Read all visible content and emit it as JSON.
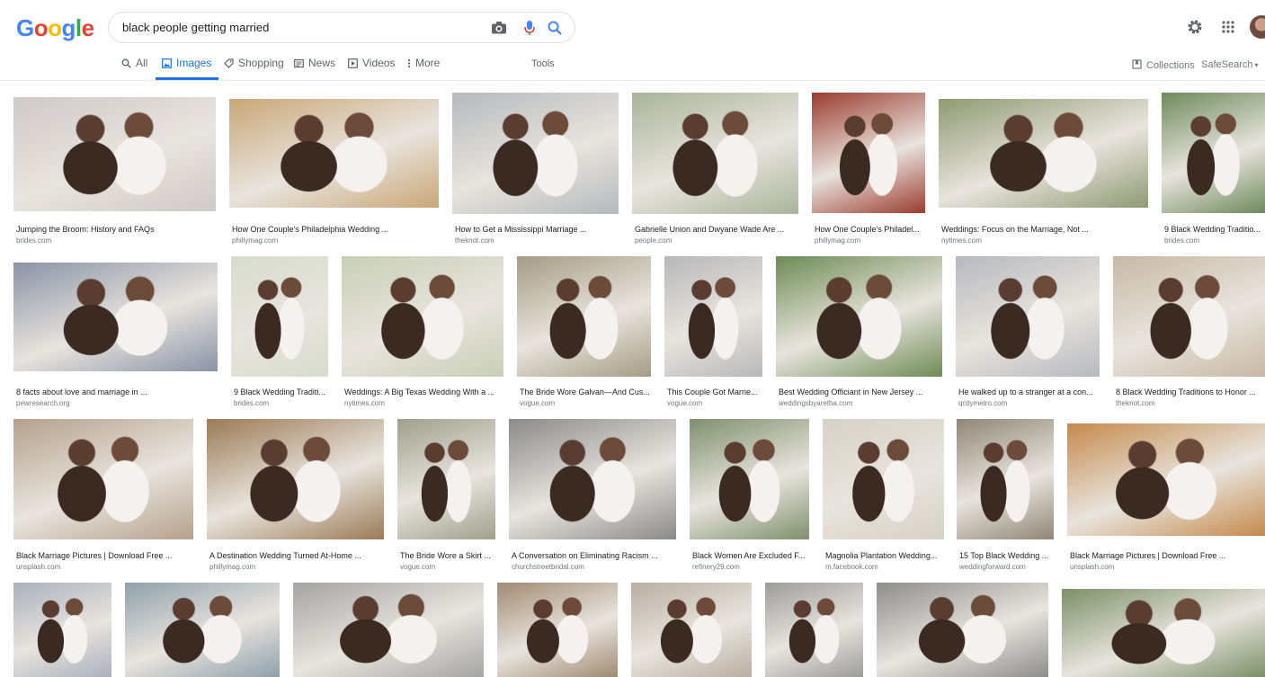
{
  "logo": {
    "letters": [
      "G",
      "o",
      "o",
      "g",
      "l",
      "e"
    ],
    "colors": [
      "#4285f4",
      "#ea4335",
      "#fbbc05",
      "#4285f4",
      "#34a853",
      "#ea4335"
    ]
  },
  "search": {
    "value": "black people getting married",
    "placeholder": ""
  },
  "icons": {
    "camera": "camera-icon",
    "mic": "microphone-icon",
    "search": "search-icon",
    "settings": "gear-icon",
    "apps": "apps-grid-icon"
  },
  "tabs": [
    {
      "label": "All",
      "icon": "search-icon",
      "active": false
    },
    {
      "label": "Images",
      "icon": "image-icon",
      "active": true
    },
    {
      "label": "Shopping",
      "icon": "tag-icon",
      "active": false
    },
    {
      "label": "News",
      "icon": "news-icon",
      "active": false
    },
    {
      "label": "Videos",
      "icon": "play-icon",
      "active": false
    },
    {
      "label": "More",
      "icon": "dots-icon",
      "active": false
    }
  ],
  "tools_label": "Tools",
  "collections_label": "Collections",
  "safesearch_label": "SafeSearch",
  "colors": {
    "accent": "#1a73e8",
    "text_secondary": "#5f6368",
    "caption": "#202124",
    "source": "#70757a"
  },
  "results": [
    {
      "title": "Jumping the Broom: History and FAQs",
      "source": "brides.com",
      "tone": "#cfc9c8"
    },
    {
      "title": "How One Couple's Philadelphia Wedding ...",
      "source": "phillymag.com",
      "tone": "#c9a776"
    },
    {
      "title": "How to Get a Mississippi Marriage ...",
      "source": "theknot.com",
      "tone": "#b5b9bd"
    },
    {
      "title": "Gabrielle Union and Dwyane Wade Are ...",
      "source": "people.com",
      "tone": "#a9b49a"
    },
    {
      "title": "How One Couple's Philadel...",
      "source": "phillymag.com",
      "tone": "#9b3b2e"
    },
    {
      "title": "Weddings: Focus on the Marriage, Not ...",
      "source": "nytimes.com",
      "tone": "#8f9a72"
    },
    {
      "title": "9 Black Wedding Traditio...",
      "source": "brides.com",
      "tone": "#6e8a5c"
    },
    {
      "title": "8 facts about love and marriage in ...",
      "source": "pewresearch.org",
      "tone": "#8b93a6"
    },
    {
      "title": "9 Black Wedding Traditi...",
      "source": "brides.com",
      "tone": "#d7dccc"
    },
    {
      "title": "Weddings: A Big Texas Wedding With a ...",
      "source": "nytimes.com",
      "tone": "#c8cfb6"
    },
    {
      "title": "The Bride Wore Galvan—And Cus...",
      "source": "vogue.com",
      "tone": "#a59c84"
    },
    {
      "title": "This Couple Got Marrie...",
      "source": "vogue.com",
      "tone": "#b8b8ba"
    },
    {
      "title": "Best Wedding Officiant in New Jersey ...",
      "source": "weddingsbyaretha.com",
      "tone": "#6e8b54"
    },
    {
      "title": "He walked up to a stranger at a con...",
      "source": "qcitymetro.com",
      "tone": "#b7b9bf"
    },
    {
      "title": "8 Black Wedding Traditions to Honor ...",
      "source": "theknot.com",
      "tone": "#c7b8a4"
    },
    {
      "title": "Black Marriage Pictures | Download Free ...",
      "source": "unsplash.com",
      "tone": "#b4a18c"
    },
    {
      "title": "A Destination Wedding Turned At-Home ...",
      "source": "phillymag.com",
      "tone": "#9a7b55"
    },
    {
      "title": "The Bride Wore a Skirt ...",
      "source": "vogue.com",
      "tone": "#9ea08c"
    },
    {
      "title": "A Conversation on Eliminating Racism ...",
      "source": "churchstreetbridal.com",
      "tone": "#8a8a8a"
    },
    {
      "title": "Black Women Are Excluded F...",
      "source": "refinery29.com",
      "tone": "#7f8f6c"
    },
    {
      "title": "Magnolia Plantation Wedding...",
      "source": "m.facebook.com",
      "tone": "#d6d2c6"
    },
    {
      "title": "15 Top Black Wedding ...",
      "source": "weddingforward.com",
      "tone": "#8f8676"
    },
    {
      "title": "Black Marriage Pictures | Download Free ...",
      "source": "unsplash.com",
      "tone": "#c58a4c"
    },
    {
      "title": "",
      "source": "",
      "tone": "#aab0bc"
    },
    {
      "title": "",
      "source": "",
      "tone": "#8fa0aa"
    },
    {
      "title": "",
      "source": "",
      "tone": "#a4a4a4"
    },
    {
      "title": "",
      "source": "",
      "tone": "#a08a72"
    },
    {
      "title": "",
      "source": "",
      "tone": "#b9aea2"
    },
    {
      "title": "",
      "source": "",
      "tone": "#9c9c9c"
    },
    {
      "title": "",
      "source": "",
      "tone": "#8d8d8d"
    },
    {
      "title": "",
      "source": "",
      "tone": "#7c9068"
    }
  ]
}
